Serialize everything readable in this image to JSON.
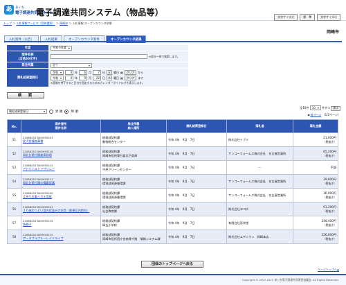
{
  "header": {
    "logo_mark": "あ",
    "logo_line1": "あいち",
    "logo_line2": "電子調達共同システム",
    "title": "電子調達共同システム（物品等）",
    "size_buttons": [
      "文字サイズ大",
      "標　準",
      "文字サイズ小"
    ]
  },
  "breadcrumb": {
    "items": [
      "トップ",
      "入札情報サービス（団体選択）",
      "岡崎市"
    ],
    "current": "入札情報:オープンカウンタ結果",
    "sep": "＞"
  },
  "org_name": "岡崎市",
  "tabs": [
    {
      "label": "入札案件（公告）",
      "active": false
    },
    {
      "label": "入札結果",
      "active": false
    },
    {
      "label": "オープンカウンタ案件",
      "active": false
    },
    {
      "label": "オープンカウンタ結果",
      "active": true
    }
  ],
  "search": {
    "year_label": "年度",
    "year_value": "令和 4年度",
    "case_name_label": "案件名称",
    "case_name_sub": "(全角50文字)",
    "case_name_note": "※部分一致で検索します。",
    "order_label": "発注所属",
    "order_value": "全て",
    "date_label": "開札結果登録日",
    "from_era": "令和",
    "from_year": "4",
    "from_month": "6",
    "from_day": "7",
    "from_dow": "水",
    "to_era": "令和",
    "to_year": "4",
    "to_month": "9",
    "to_day": "22",
    "to_dow": "木",
    "unit_year": "年",
    "unit_month": "月",
    "unit_day": "日",
    "dow_suffix": "曜日",
    "clear_label": "クリア",
    "from_word": "から",
    "to_word": "まで",
    "date_note": "※画像を押下すると日付を指定するためのカレンダーダイアログを表示します。",
    "search_button": "検　索"
  },
  "sort": {
    "field_value": "開札結果登録日",
    "asc_label": "昇 順",
    "desc_label": "降 順"
  },
  "pager": {
    "count_text": "全18件",
    "per_page": "10",
    "per_page_suffix": "件ずつ",
    "display_button": "表示",
    "prev_link": "前ページ",
    "pages": "（1/2ページ）"
  },
  "table": {
    "headers": [
      "No.",
      "案件番号\n案件名称",
      "発注所属\n納入場所",
      "開札結果登録日",
      "落札者",
      "落札金額"
    ],
    "rows": [
      {
        "no": "51",
        "code": "220682523000955203",
        "name": "愛犬愛護推薦書",
        "dept": "総務部契約課",
        "place": "動物総合センター",
        "date": "令和 4年　9月　7日",
        "winner": "株式会社イブミ",
        "amount": "21,000円",
        "tax": "（税抜き）"
      },
      {
        "no": "52",
        "code": "220682523000955218",
        "name": "岡北分館付属倉庫修理",
        "dept": "総務部契約課",
        "place": "岡崎市役所東行倉北下倉庫",
        "date": "令和 4年　9月　7日",
        "winner": "サンコーフォームズ株式会社　名古屋営業所",
        "amount": "85,200円",
        "tax": "（税抜き）"
      },
      {
        "no": "53",
        "code": "220682523000955213",
        "name": "アドバンストリサリレー",
        "dept": "総務部契約課",
        "place": "中央クリーンセンター",
        "date": "令和 4年　9月　7日",
        "winner": "－",
        "amount": "不調",
        "tax": ""
      },
      {
        "no": "54",
        "code": "220682523000955211",
        "name": "岡北分館付属の備蓄保護",
        "dept": "総務部契約課",
        "place": "環境部資源循環課",
        "date": "令和 4年　9月　7日",
        "winner": "サンコーフォームズ株式会社　名古屋営業所",
        "amount": "39,600円",
        "tax": "（税抜き）"
      },
      {
        "no": "55",
        "code": "220682523000955209",
        "name": "Ｚ折り圧着ハガキ用紙",
        "dept": "総務部契約課",
        "place": "環境部資源循環課",
        "date": "令和 4年　9月　7日",
        "winner": "サンコーフォームズ株式会社　名古屋営業所",
        "amount": "36,000円",
        "tax": "（税抜き）"
      },
      {
        "no": "56",
        "code": "220682523000955202",
        "name": "２０歳のつどい案内状並みガ封筒（郵便区内特別）",
        "dept": "総務部契約課",
        "place": "社会教育課",
        "date": "令和 4年　9月　7日",
        "winner": "株式会社ヨコタ",
        "amount": "91,290円",
        "tax": "（税抜き）"
      },
      {
        "no": "57",
        "code": "220682523000955219",
        "name": "角棚子",
        "dept": "総務部契約課",
        "place": "緑丘小学校",
        "date": "令和 4年　9月　7日",
        "winner": "有限会社彩栄堂",
        "amount": "248,400円",
        "tax": "（税抜き）"
      },
      {
        "no": "58",
        "code": "220682523000955215",
        "name": "ポータブルブルーレイドライブ",
        "dept": "総務部契約課",
        "place": "岡崎市役所西庁舎南棟４階　情報システム課",
        "date": "令和 4年　9月　7日",
        "winner": "株式会社エディオン　岡崎本店",
        "amount": "226,000円",
        "tax": "（税抜き）"
      }
    ]
  },
  "back_button": "団体のトップページへ戻る",
  "page_top_link": "ページトップへ",
  "footer_text": "Copyright © 2007-2022 あいち電子調達共同運営協議会. All Rights Reserved."
}
